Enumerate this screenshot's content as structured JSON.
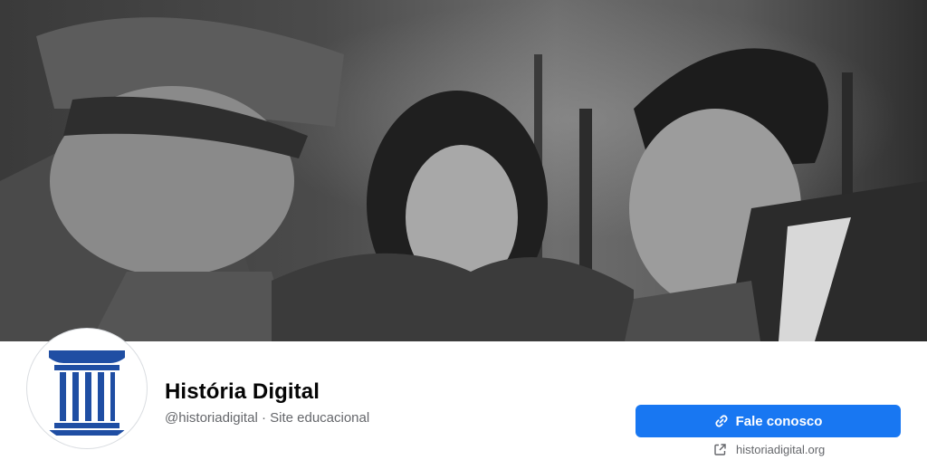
{
  "cover": {
    "description_icon": "cover-photo"
  },
  "profile": {
    "name": "História Digital",
    "handle": "@historiadigital",
    "separator": " · ",
    "category": "Site educacional",
    "avatar_icon": "column-logo-icon",
    "brand_color": "#1f4ea3"
  },
  "actions": {
    "contact_label": "Fale conosco",
    "contact_icon": "link-icon",
    "button_color": "#1877f2",
    "website_label": "historiadigital.org",
    "website_icon": "external-link-icon"
  }
}
